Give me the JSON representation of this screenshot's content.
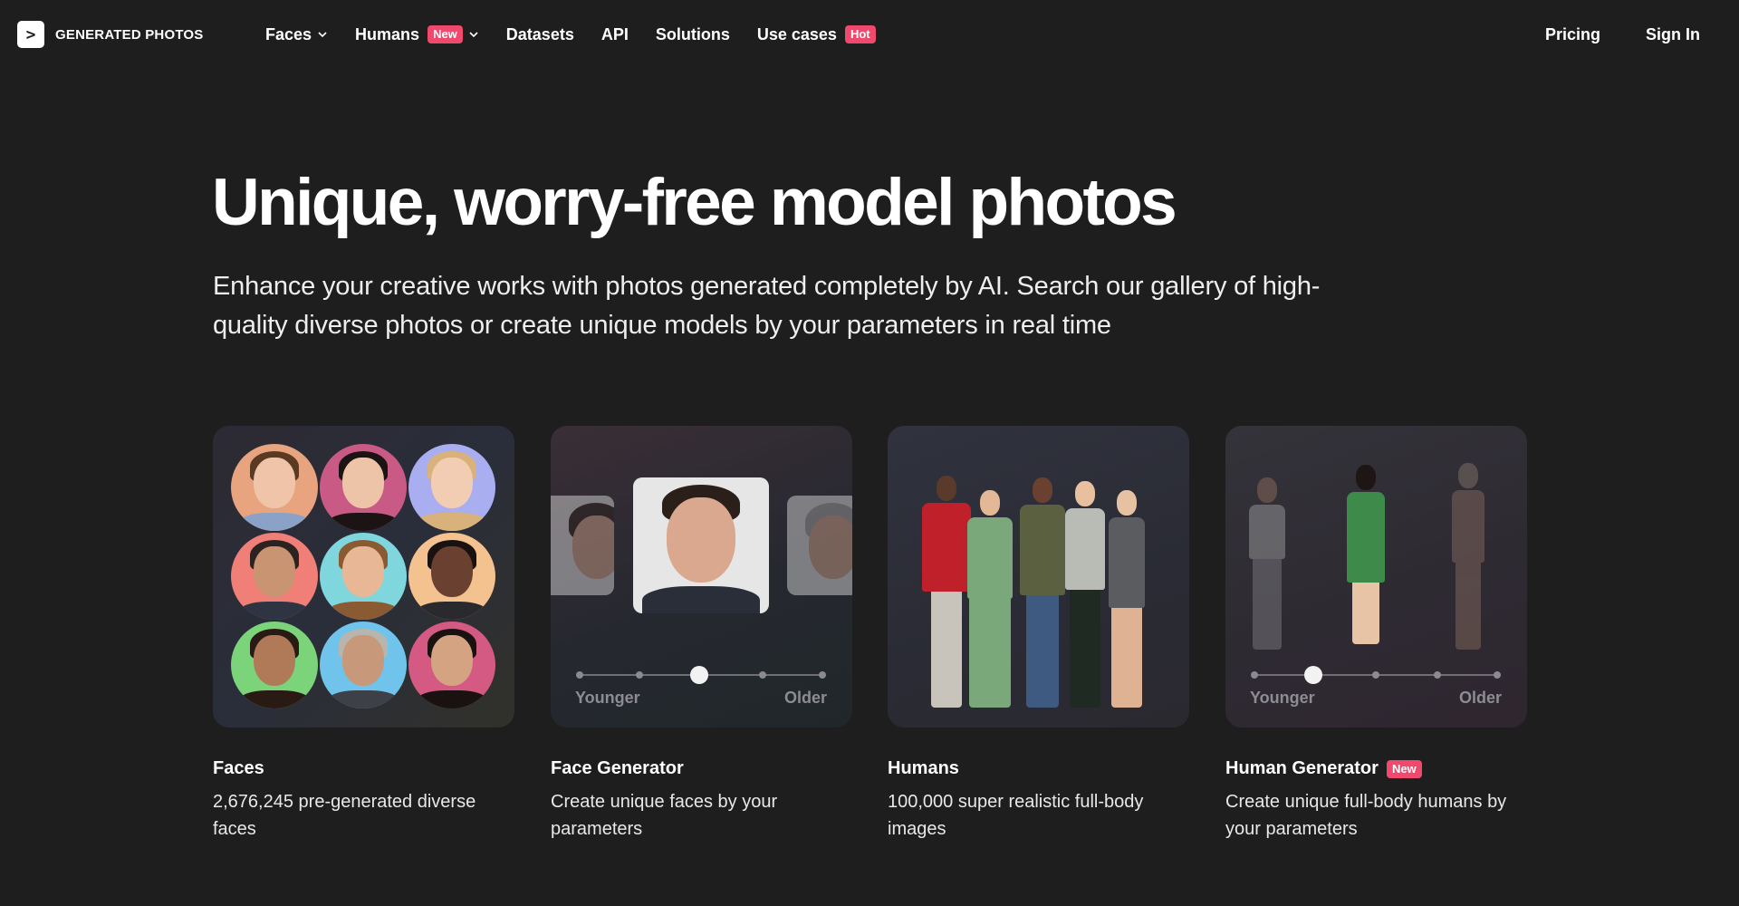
{
  "nav": {
    "logo_text": "GENERATED PHOTOS",
    "items": [
      {
        "label": "Faces",
        "has_dropdown": true
      },
      {
        "label": "Humans",
        "badge": "New",
        "has_dropdown": true
      },
      {
        "label": "Datasets"
      },
      {
        "label": "API"
      },
      {
        "label": "Solutions"
      },
      {
        "label": "Use cases",
        "badge": "Hot"
      }
    ],
    "pricing": "Pricing",
    "sign_in": "Sign In"
  },
  "hero": {
    "title": "Unique, worry-free model photos",
    "subtitle": "Enhance your creative works with photos generated completely by AI. Search our gallery of high-quality diverse photos or create unique models by your parameters in real time"
  },
  "cards": [
    {
      "title": "Faces",
      "desc": "2,676,245 pre-generated diverse faces"
    },
    {
      "title": "Face Generator",
      "desc": "Create unique faces by your parameters",
      "slider_left": "Younger",
      "slider_right": "Older"
    },
    {
      "title": "Humans",
      "desc": "100,000 super realistic full-body images"
    },
    {
      "title": "Human Generator",
      "badge": "New",
      "desc": "Create unique full-body humans by your parameters",
      "slider_left": "Younger",
      "slider_right": "Older"
    }
  ],
  "colors": {
    "background": "#1e1e1e",
    "badge": "#f0496e"
  }
}
